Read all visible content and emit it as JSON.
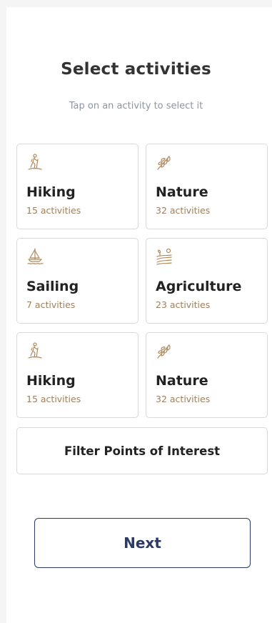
{
  "header": {
    "title": "Select activities",
    "subtitle": "Tap on an activity to select it"
  },
  "activities": [
    {
      "name": "Hiking",
      "count": "15 activities",
      "icon": "hiker-icon"
    },
    {
      "name": "Nature",
      "count": "32 activities",
      "icon": "leaf-icon"
    },
    {
      "name": "Sailing",
      "count": "7 activities",
      "icon": "sailboat-icon"
    },
    {
      "name": "Agriculture",
      "count": "23 activities",
      "icon": "farm-icon"
    },
    {
      "name": "Hiking",
      "count": "15 activities",
      "icon": "hiker-icon"
    },
    {
      "name": "Nature",
      "count": "32 activities",
      "icon": "leaf-icon"
    }
  ],
  "actions": {
    "filter_label": "Filter Points of Interest",
    "next_label": "Next"
  },
  "colors": {
    "accent": "#2b3a67",
    "icon": "#b08a5e",
    "count_text": "#a07f5c",
    "subtitle_text": "#8c95a3"
  }
}
